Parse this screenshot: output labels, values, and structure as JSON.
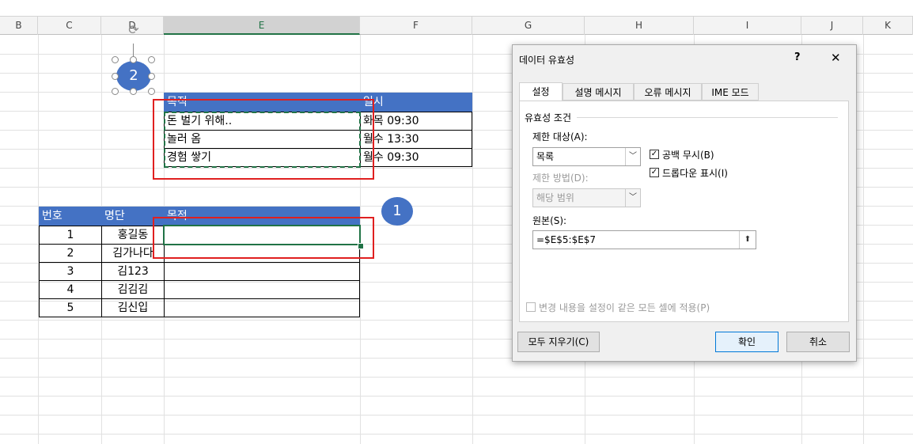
{
  "columns": [
    "B",
    "C",
    "D",
    "E",
    "F",
    "G",
    "H",
    "I",
    "J",
    "K"
  ],
  "selected_column": "E",
  "callouts": {
    "one": "1",
    "two": "2"
  },
  "purpose_table": {
    "headers": [
      "목적",
      "일시"
    ],
    "rows": [
      [
        "돈 벌기 위해..",
        "화목 09:30"
      ],
      [
        "놀러 옴",
        "월수 13:30"
      ],
      [
        "경험 쌓기",
        "월수 09:30"
      ]
    ]
  },
  "roster_table": {
    "headers": [
      "번호",
      "명단",
      "목적"
    ],
    "rows": [
      [
        "1",
        "홍길동",
        ""
      ],
      [
        "2",
        "김가나다",
        ""
      ],
      [
        "3",
        "김123",
        ""
      ],
      [
        "4",
        "김김김",
        ""
      ],
      [
        "5",
        "김신입",
        ""
      ]
    ]
  },
  "dialog": {
    "title": "데이터 유효성",
    "help": "?",
    "close": "✕",
    "tabs": [
      "설정",
      "설명 메시지",
      "오류 메시지",
      "IME 모드"
    ],
    "section": "유효성 조건",
    "allow_label": "제한 대상(A):",
    "allow_value": "목록",
    "ignore_blank": "공백 무시(B)",
    "in_cell_dropdown": "드롭다운 표시(I)",
    "data_label": "제한 방법(D):",
    "data_value": "해당 범위",
    "source_label": "원본(S):",
    "source_value": "=$E$5:$E$7",
    "apply_all": "변경 내용을 설정이 같은 모든 셀에 적용(P)",
    "clear_all": "모두 지우기(C)",
    "ok": "확인",
    "cancel": "취소"
  }
}
